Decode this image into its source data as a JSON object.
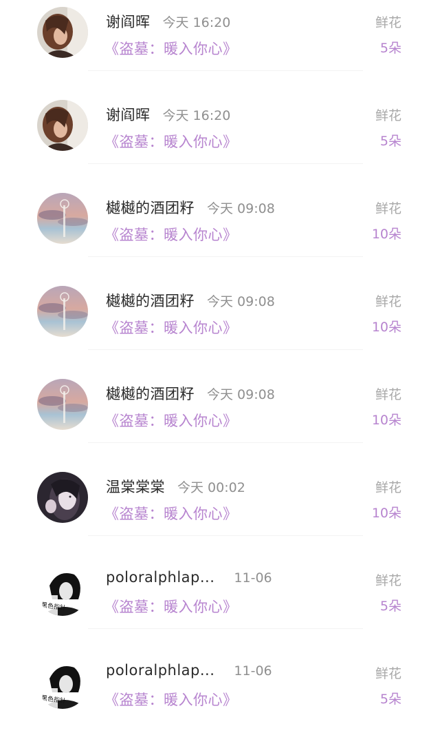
{
  "items": [
    {
      "avatar": "girl-hair-photo",
      "name": "谢阎晖",
      "time": "今天 16:20",
      "book": "《盗墓：暖入你心》",
      "gift_type": "鲜花",
      "gift_count": "5朵"
    },
    {
      "avatar": "girl-hair-photo",
      "name": "谢阎晖",
      "time": "今天 16:20",
      "book": "《盗墓：暖入你心》",
      "gift_type": "鲜花",
      "gift_count": "5朵"
    },
    {
      "avatar": "sky-sunset",
      "name": "樾樾的酒团籽",
      "time": "今天 09:08",
      "book": "《盗墓：暖入你心》",
      "gift_type": "鲜花",
      "gift_count": "10朵"
    },
    {
      "avatar": "sky-sunset",
      "name": "樾樾的酒团籽",
      "time": "今天 09:08",
      "book": "《盗墓：暖入你心》",
      "gift_type": "鲜花",
      "gift_count": "10朵"
    },
    {
      "avatar": "sky-sunset",
      "name": "樾樾的酒团籽",
      "time": "今天 09:08",
      "book": "《盗墓：暖入你心》",
      "gift_type": "鲜花",
      "gift_count": "10朵"
    },
    {
      "avatar": "illustrated-portrait",
      "name": "温棠棠棠",
      "time": "今天 00:02",
      "book": "《盗墓：暖入你心》",
      "gift_type": "鲜花",
      "gift_count": "10朵"
    },
    {
      "avatar": "bw-boy-portrait",
      "avatar_text": "黑色指针",
      "name": "poloralphlap...",
      "time": "11-06",
      "book": "《盗墓：暖入你心》",
      "gift_type": "鲜花",
      "gift_count": "5朵"
    },
    {
      "avatar": "bw-boy-portrait",
      "avatar_text": "黑色指针",
      "name": "poloralphlap...",
      "time": "11-06",
      "book": "《盗墓：暖入你心》",
      "gift_type": "鲜花",
      "gift_count": "5朵"
    }
  ],
  "colors": {
    "accent": "#b784cf",
    "name": "#2a2a2a",
    "muted": "#8f8f8f",
    "gift_label": "#a8a8a8"
  }
}
